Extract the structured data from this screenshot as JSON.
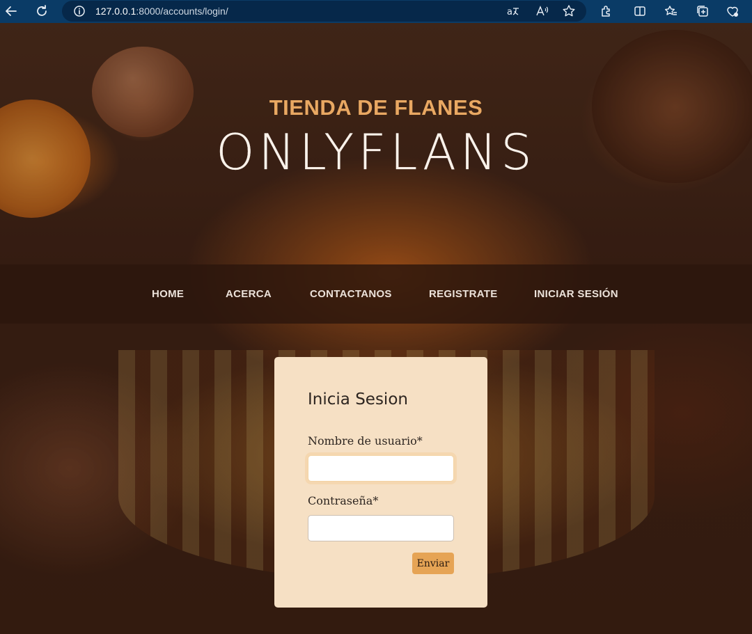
{
  "browser": {
    "url_host": "127.0.0.1",
    "url_path": ":8000/accounts/login/"
  },
  "header": {
    "subtitle": "TIENDA DE FLANES",
    "title": "ONLYFLANS"
  },
  "nav": {
    "items": [
      {
        "label": "HOME"
      },
      {
        "label": "ACERCA"
      },
      {
        "label": "CONTACTANOS"
      },
      {
        "label": "REGISTRATE"
      },
      {
        "label": "INICIAR SESIÓN"
      }
    ]
  },
  "login": {
    "title": "Inicia Sesion",
    "username_label": "Nombre de usuario*",
    "username_value": "",
    "password_label": "Contraseña*",
    "password_value": "",
    "submit_label": "Enviar"
  },
  "colors": {
    "accent": "#e9a862",
    "nav_bg": "#2c160c",
    "card_bg": "#f6e0c4",
    "button": "#e6a455"
  }
}
